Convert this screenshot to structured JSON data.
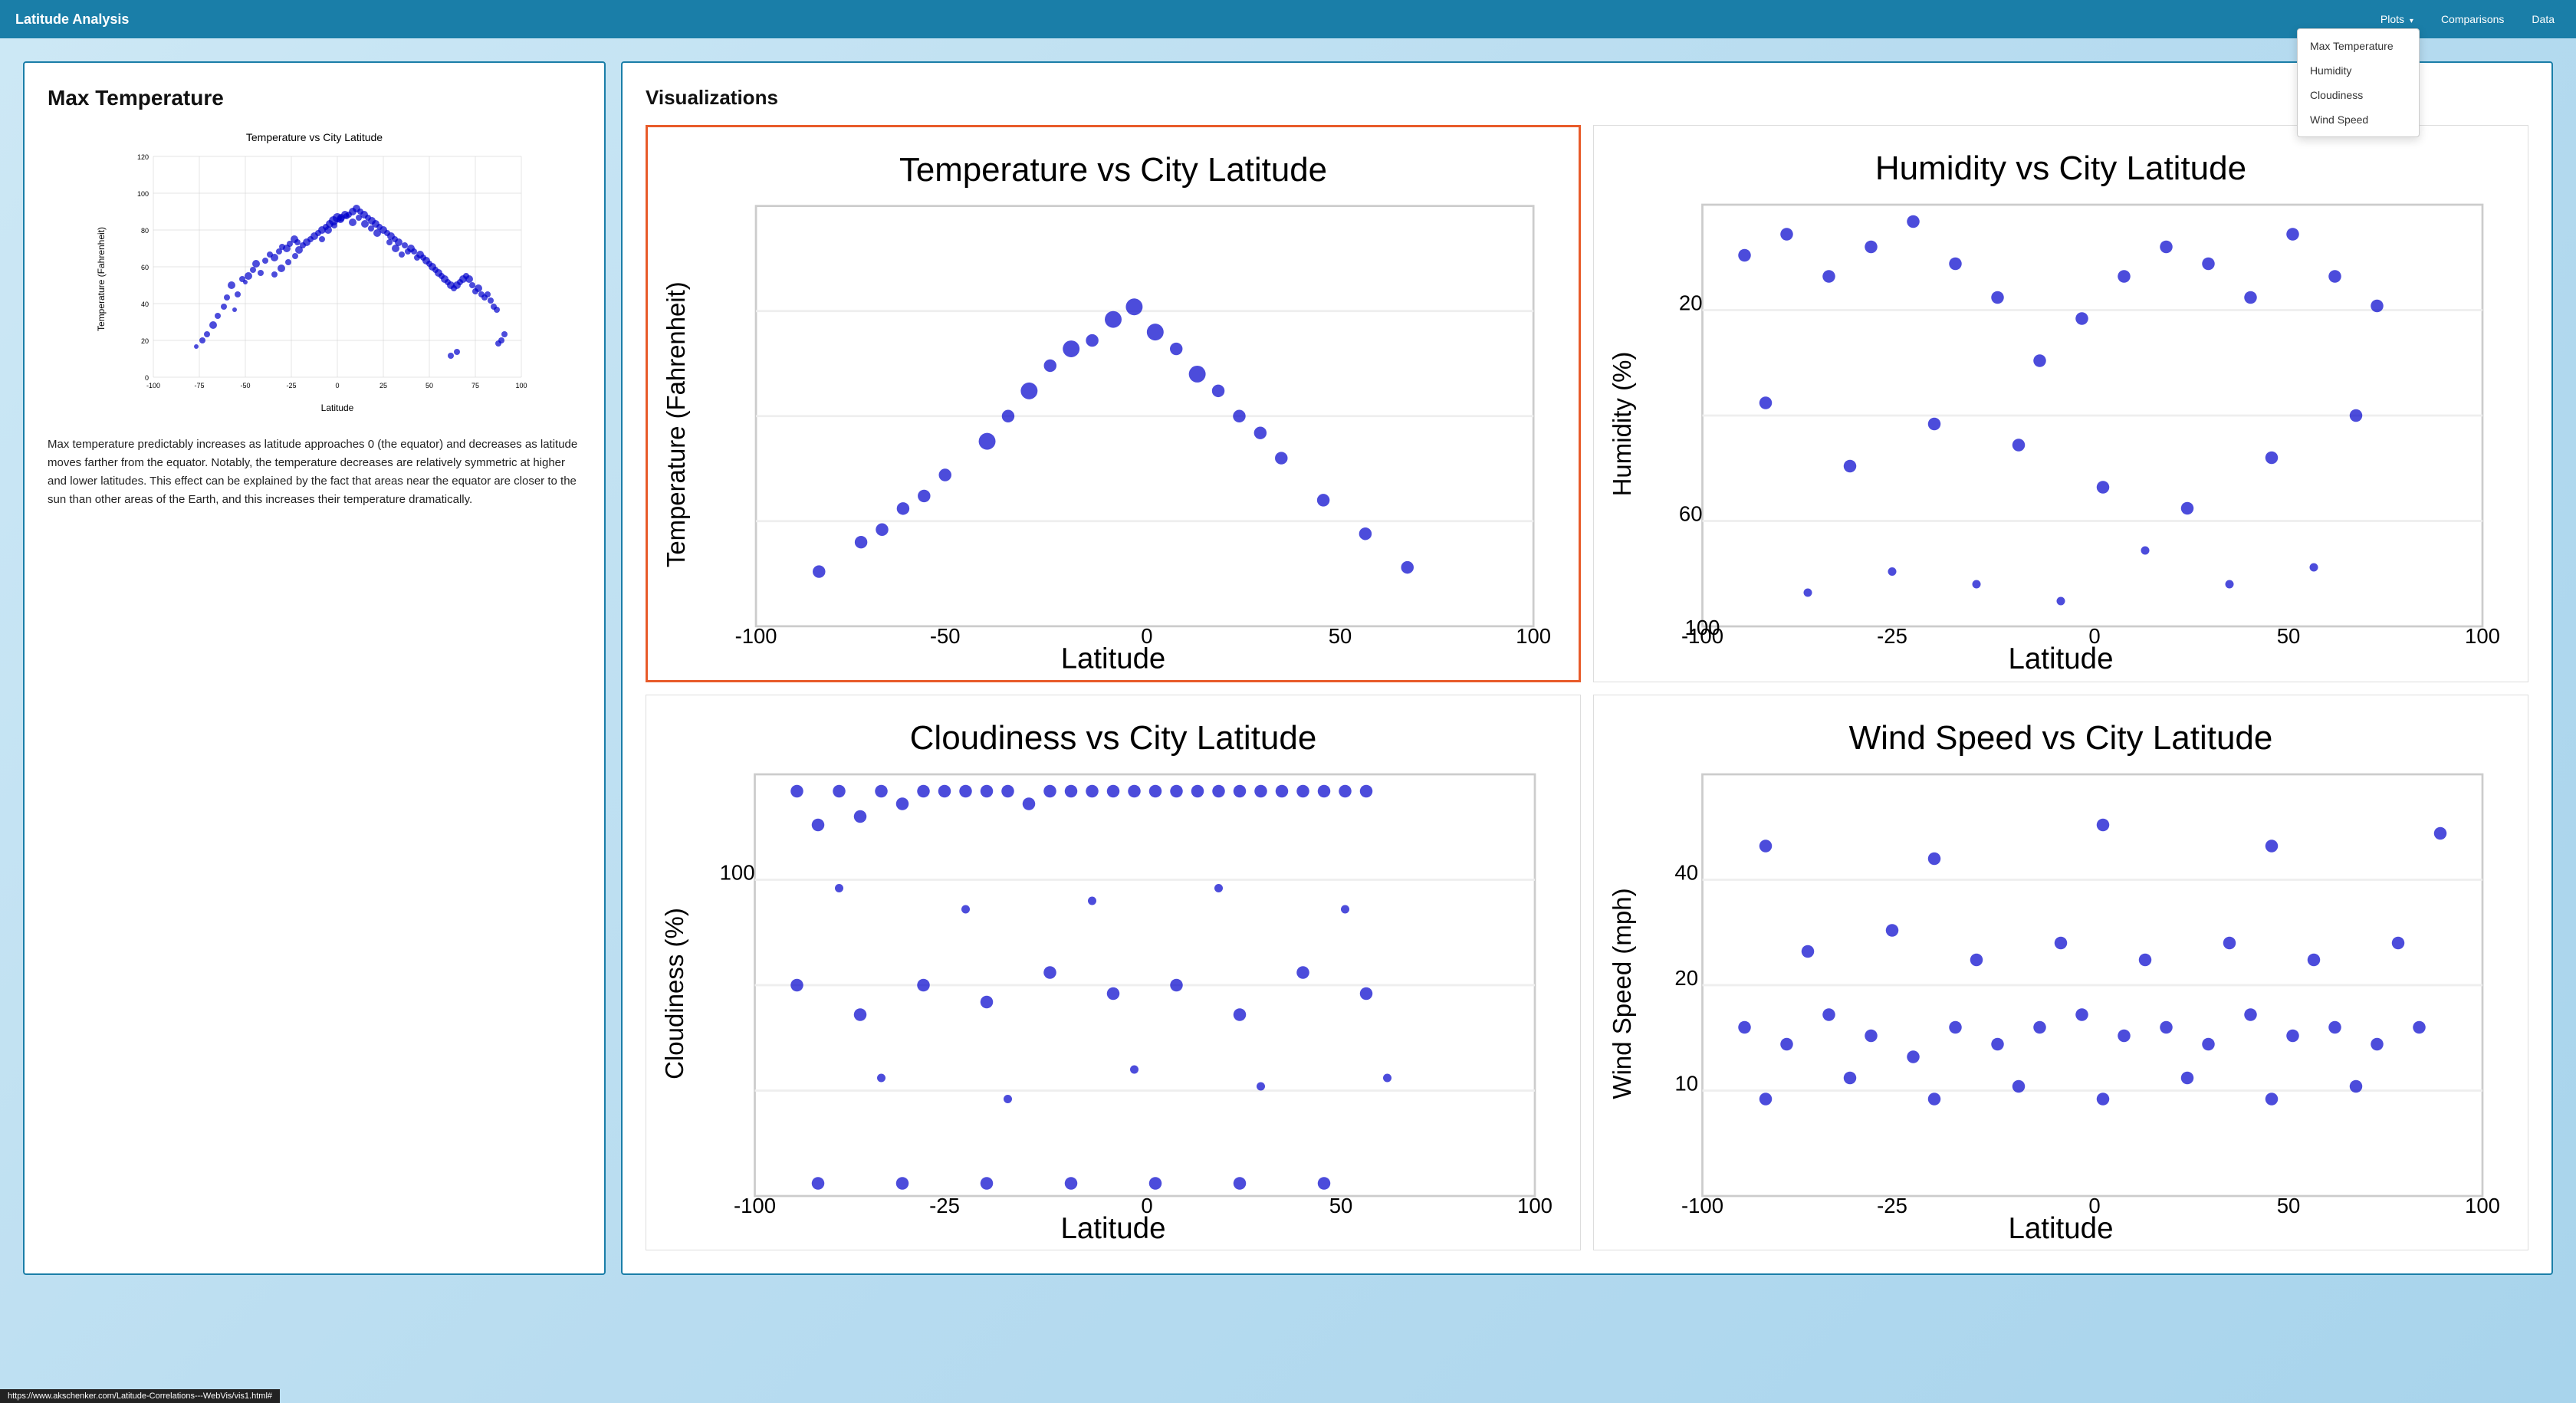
{
  "app": {
    "title": "Latitude Analysis",
    "url": "https://www.akschenker.com/Latitude-Correlations---WebVis/vis1.html#"
  },
  "navbar": {
    "brand": "Latitude Analysis",
    "items": [
      {
        "label": "Plots",
        "dropdown": true,
        "items": [
          "Max Temperature",
          "Humidity",
          "Cloudiness",
          "Wind Speed"
        ]
      },
      {
        "label": "Comparisons",
        "dropdown": false
      },
      {
        "label": "Data",
        "dropdown": false
      }
    ]
  },
  "left_card": {
    "title": "Max Temperature",
    "chart_title": "Temperature vs City Latitude",
    "x_label": "Latitude",
    "y_label": "Temperature (Fahrenheit)",
    "description": "Max temperature predictably increases as latitude approaches 0 (the equator) and decreases as latitude moves farther from the equator. Notably, the temperature decreases are relatively symmetric at higher and lower latitudes. This effect can be explained by the fact that areas near the equator are closer to the sun than other areas of the Earth, and this increases their temperature dramatically."
  },
  "right_card": {
    "title": "Visualizations",
    "charts": [
      {
        "title": "Temperature vs City Latitude",
        "active": true
      },
      {
        "title": "Humidity vs City Latitude",
        "active": false
      },
      {
        "title": "Cloudiness vs City Latitude",
        "active": false
      },
      {
        "title": "Wind Speed vs City Latitude",
        "active": false
      }
    ]
  },
  "dropdown": {
    "items": [
      "Max Temperature",
      "Humidity",
      "Cloudiness",
      "Wind Speed"
    ]
  }
}
